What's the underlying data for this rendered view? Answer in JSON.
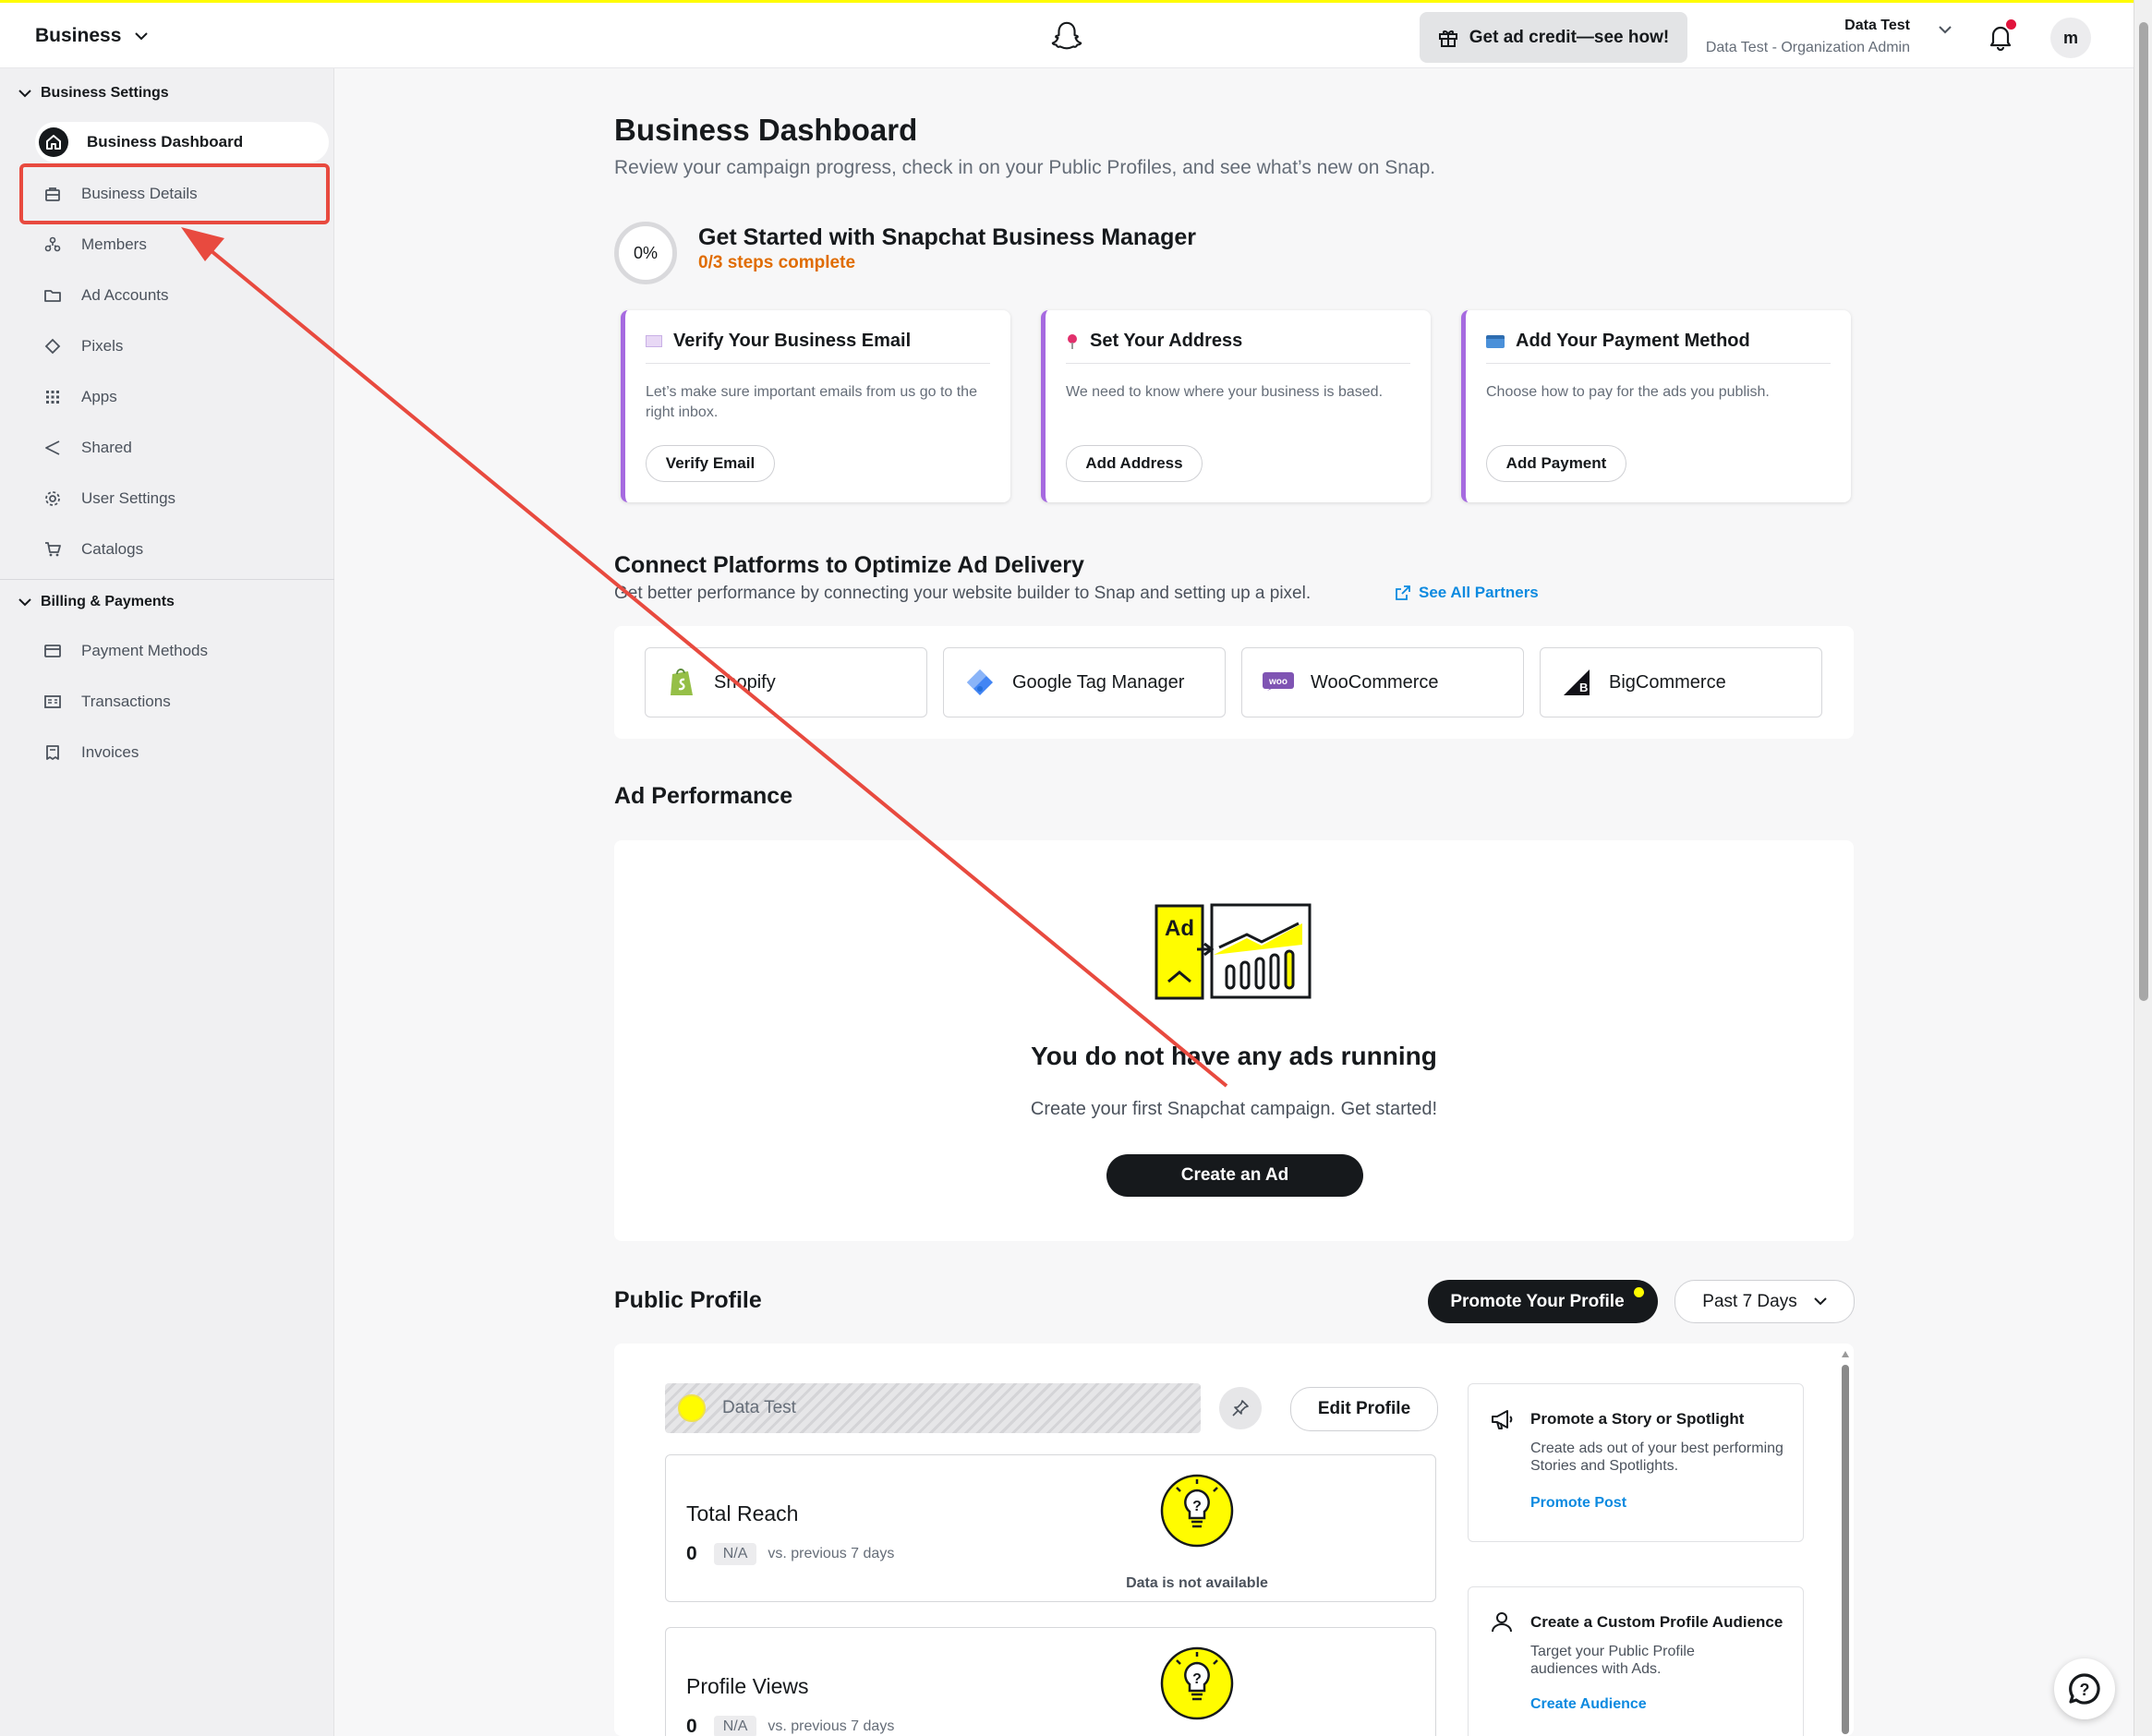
{
  "topbar": {
    "business_switcher": "Business",
    "ad_credit": "Get ad credit—see how!",
    "account_name": "Data Test",
    "account_role": "Data Test - Organization Admin",
    "avatar_initial": "m"
  },
  "sidebar": {
    "section1": "Business Settings",
    "items1": [
      {
        "label": "Business Dashboard",
        "icon": "home-icon"
      },
      {
        "label": "Business Details",
        "icon": "briefcase-icon"
      },
      {
        "label": "Members",
        "icon": "members-icon"
      },
      {
        "label": "Ad Accounts",
        "icon": "folder-icon"
      },
      {
        "label": "Pixels",
        "icon": "diamond-icon"
      },
      {
        "label": "Apps",
        "icon": "grid-icon"
      },
      {
        "label": "Shared",
        "icon": "share-icon"
      },
      {
        "label": "User Settings",
        "icon": "gear-icon"
      },
      {
        "label": "Catalogs",
        "icon": "cart-icon"
      }
    ],
    "section2": "Billing & Payments",
    "items2": [
      {
        "label": "Payment Methods",
        "icon": "card-icon"
      },
      {
        "label": "Transactions",
        "icon": "receipt-icon"
      },
      {
        "label": "Invoices",
        "icon": "invoice-icon"
      }
    ]
  },
  "main": {
    "title": "Business Dashboard",
    "subtitle": "Review your campaign progress, check in on your Public Profiles, and see what’s new on Snap.",
    "progress_text": "0%",
    "getstarted_title": "Get Started with Snapchat Business Manager",
    "getstarted_steps": "0/3 steps complete",
    "cards": [
      {
        "title": "Verify Your Business Email",
        "desc": "Let’s make sure important emails from us go to the right inbox.",
        "button": "Verify Email"
      },
      {
        "title": "Set Your Address",
        "desc": "We need to know where your business is based.",
        "button": "Add Address"
      },
      {
        "title": "Add Your Payment Method",
        "desc": "Choose how to pay for the ads you publish.",
        "button": "Add Payment"
      }
    ],
    "connect_title": "Connect Platforms to Optimize Ad Delivery",
    "connect_sub": "Get better performance by connecting your website builder to Snap and setting up a pixel.",
    "see_all": "See All Partners",
    "platforms": [
      "Shopify",
      "Google Tag Manager",
      "WooCommerce",
      "BigCommerce"
    ],
    "adperf_title": "Ad Performance",
    "illustration_ad": "Ad",
    "empty_title": "You do not have any ads running",
    "empty_sub": "Create your first Snapchat campaign. Get started!",
    "create_ad": "Create an Ad",
    "pp_title": "Public Profile",
    "promote_profile": "Promote Your Profile",
    "range": "Past 7 Days",
    "profile_name": "Data Test",
    "edit_profile": "Edit Profile",
    "stats": [
      {
        "title": "Total Reach",
        "value": "0",
        "na": "N/A",
        "vs": "vs. previous 7 days",
        "note": "Data is not available"
      },
      {
        "title": "Profile Views",
        "value": "0",
        "na": "N/A",
        "vs": "vs. previous 7 days"
      }
    ],
    "side_cards": [
      {
        "title": "Promote a Story or Spotlight",
        "desc": "Create ads out of your best performing Stories and Spotlights.",
        "link": "Promote Post"
      },
      {
        "title": "Create a Custom Profile Audience",
        "desc": "Target your Public Profile audiences with Ads.",
        "link": "Create Audience"
      }
    ]
  },
  "colors": {
    "accent_yellow": "#fffc00",
    "highlight_red": "#e84a3f",
    "link_blue": "#0c8ae0",
    "steps_orange": "#e06c00",
    "card_border_purple": "#a66ae0"
  }
}
